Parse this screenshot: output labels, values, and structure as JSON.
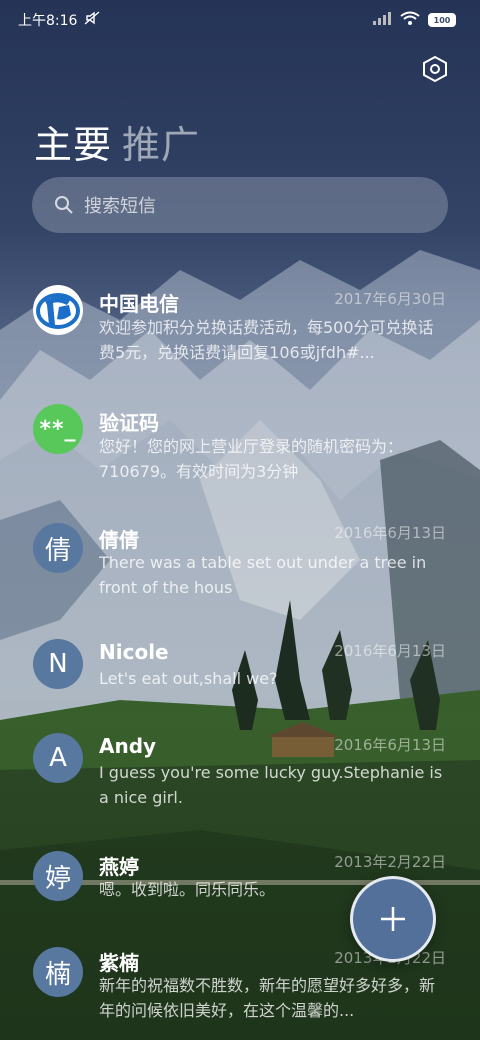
{
  "status_bar": {
    "time": "上午8:16",
    "battery": "100"
  },
  "tabs": [
    {
      "label": "主要",
      "active": true
    },
    {
      "label": "推广",
      "active": false
    }
  ],
  "search": {
    "placeholder": "搜索短信"
  },
  "conversations": [
    {
      "name": "中国电信",
      "date": "2017年6月30日",
      "preview": "欢迎参加积分兑换话费活动，每500分可兑换话费5元，兑换话费请回复106或jfdh#...",
      "avatar_type": "telecom-logo-icon"
    },
    {
      "name": "验证码",
      "date": "",
      "preview": "您好！您的网上营业厅登录的随机密码为：710679。有效时间为3分钟",
      "avatar_text": "**_",
      "avatar_color": "#58c85a"
    },
    {
      "name": "倩倩",
      "date": "2016年6月13日",
      "preview": "There was a table set out under a tree in front of the hous",
      "avatar_text": "倩"
    },
    {
      "name": "Nicole",
      "date": "2016年6月13日",
      "preview": "Let's eat out,shall we?",
      "avatar_text": "N"
    },
    {
      "name": "Andy",
      "date": "2016年6月13日",
      "preview": "I guess you're some lucky guy.Stephanie is a nice girl.",
      "avatar_text": "A"
    },
    {
      "name": "燕婷",
      "date": "2013年2月22日",
      "preview": "嗯。收到啦。同乐同乐。",
      "avatar_text": "婷"
    },
    {
      "name": "紫楠",
      "date": "2013年2月22日",
      "preview": "新年的祝福数不胜数，新年的愿望好多好多，新年的问候依旧美好，在这个温馨的...",
      "avatar_text": "楠"
    }
  ],
  "colors": {
    "avatar_default": "#5878a0",
    "fab": "#52709a"
  }
}
